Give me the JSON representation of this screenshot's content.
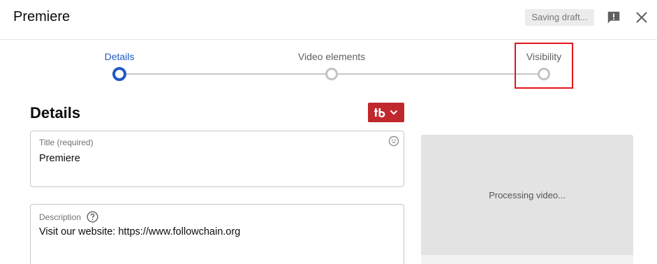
{
  "header": {
    "title": "Premiere",
    "saving_status": "Saving draft..."
  },
  "stepper": {
    "steps": [
      {
        "label": "Details",
        "state": "active"
      },
      {
        "label": "Video elements",
        "state": "inactive"
      },
      {
        "label": "Visibility",
        "state": "inactive",
        "highlighted": true
      }
    ]
  },
  "details": {
    "section_title": "Details",
    "title_field": {
      "label": "Title (required)",
      "value": "Premiere"
    },
    "description_field": {
      "label": "Description",
      "value": "Visit our website: https://www.followchain.org"
    }
  },
  "preview": {
    "status": "Processing video..."
  },
  "icons": {
    "feedback": "feedback-icon",
    "close": "close-icon",
    "emoji": "emoji-icon",
    "help": "help-circle-icon",
    "extension": "tubebuddy-logo-icon",
    "dropdown": "chevron-down-icon"
  },
  "colors": {
    "accent": "#1f5bc2",
    "highlight": "#e0151a",
    "extension_button": "#c0282d"
  }
}
